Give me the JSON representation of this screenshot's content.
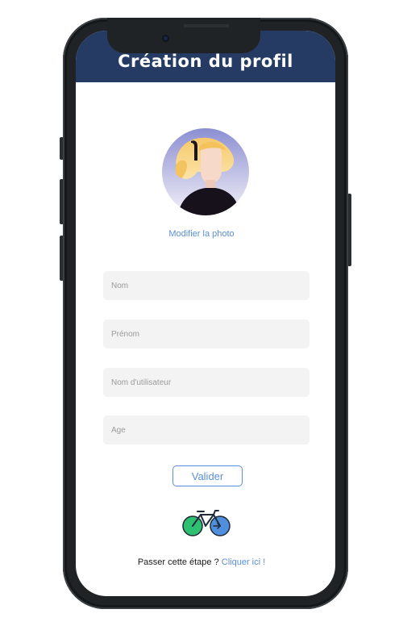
{
  "header": {
    "title": "Création du profil"
  },
  "profile": {
    "modify_photo_label": "Modifier la photo"
  },
  "form": {
    "fields": [
      {
        "placeholder": "Nom",
        "value": ""
      },
      {
        "placeholder": "Prénom",
        "value": ""
      },
      {
        "placeholder": "Nom d'utilisateur",
        "value": ""
      },
      {
        "placeholder": "Age",
        "value": ""
      }
    ],
    "submit_label": "Valider"
  },
  "footer": {
    "skip_prefix": "Passer cette étape ? ",
    "skip_link": "Cliquer ici !"
  },
  "icons": {
    "logo": "bicycle-icon",
    "avatar": "user-avatar"
  },
  "colors": {
    "header_bg": "#263b63",
    "accent": "#5b8fd9",
    "field_bg": "#f3f3f3",
    "bike_green": "#2fbf71",
    "bike_blue": "#4f8fdc"
  }
}
